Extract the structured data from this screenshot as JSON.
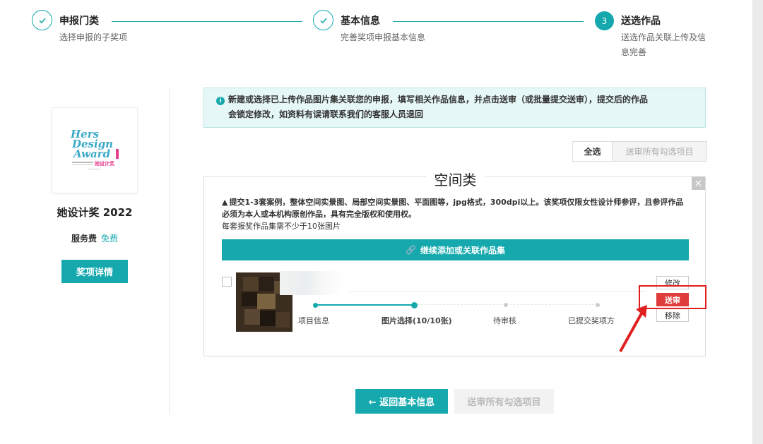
{
  "stepper": {
    "steps": [
      {
        "title": "申报门类",
        "desc": "选择申报的子奖项",
        "state": "done"
      },
      {
        "title": "基本信息",
        "desc": "完善奖项申报基本信息",
        "state": "done"
      },
      {
        "number": "3",
        "title": "送选作品",
        "desc_line1": "送选作品关联上传及信",
        "desc_line2": "息完善",
        "state": "active"
      }
    ]
  },
  "award": {
    "logo_text": [
      "Hers",
      "Design",
      "Award"
    ],
    "logo_sub": "她设计奖",
    "name": "她设计奖 2022",
    "fee_label": "服务费",
    "fee_value": "免费",
    "detail_button": "奖项详情"
  },
  "notice": {
    "line1": "新建或选择已上传作品图片集关联您的申报，填写相关作品信息，并点击送审（或批量提交送审），提交后的作品",
    "line2": "会锁定修改，如资料有误请联系我们的客服人员退回"
  },
  "toolbar": {
    "select_all": "全选",
    "submit_all": "送审所有勾选项目"
  },
  "category": {
    "title": "空间类",
    "close": "×",
    "rules_line1": "提交1-3套案例，整体空间实景图、局部空间实景图、平面图等，jpg格式，300dpi以上。该奖项仅限女性设计师参评，且参评作品",
    "rules_line2": "必须为本人或本机构原创作品，具有完全版权和使用权。",
    "rules_line3": "每套报奖作品集需不少于10张图片",
    "add_button": "继续添加或关联作品集",
    "work": {
      "steps": [
        "项目信息",
        "图片选择(10/10张)",
        "待审核",
        "已提交奖项方"
      ],
      "completed_steps": 2,
      "edit": "修改",
      "submit": "送审",
      "remove": "移除"
    }
  },
  "footer": {
    "back": "← 返回基本信息",
    "submit_all": "送审所有勾选项目"
  },
  "colors": {
    "accent": "#15a9ad",
    "danger": "#e03c3c",
    "highlight": "#e02020"
  }
}
